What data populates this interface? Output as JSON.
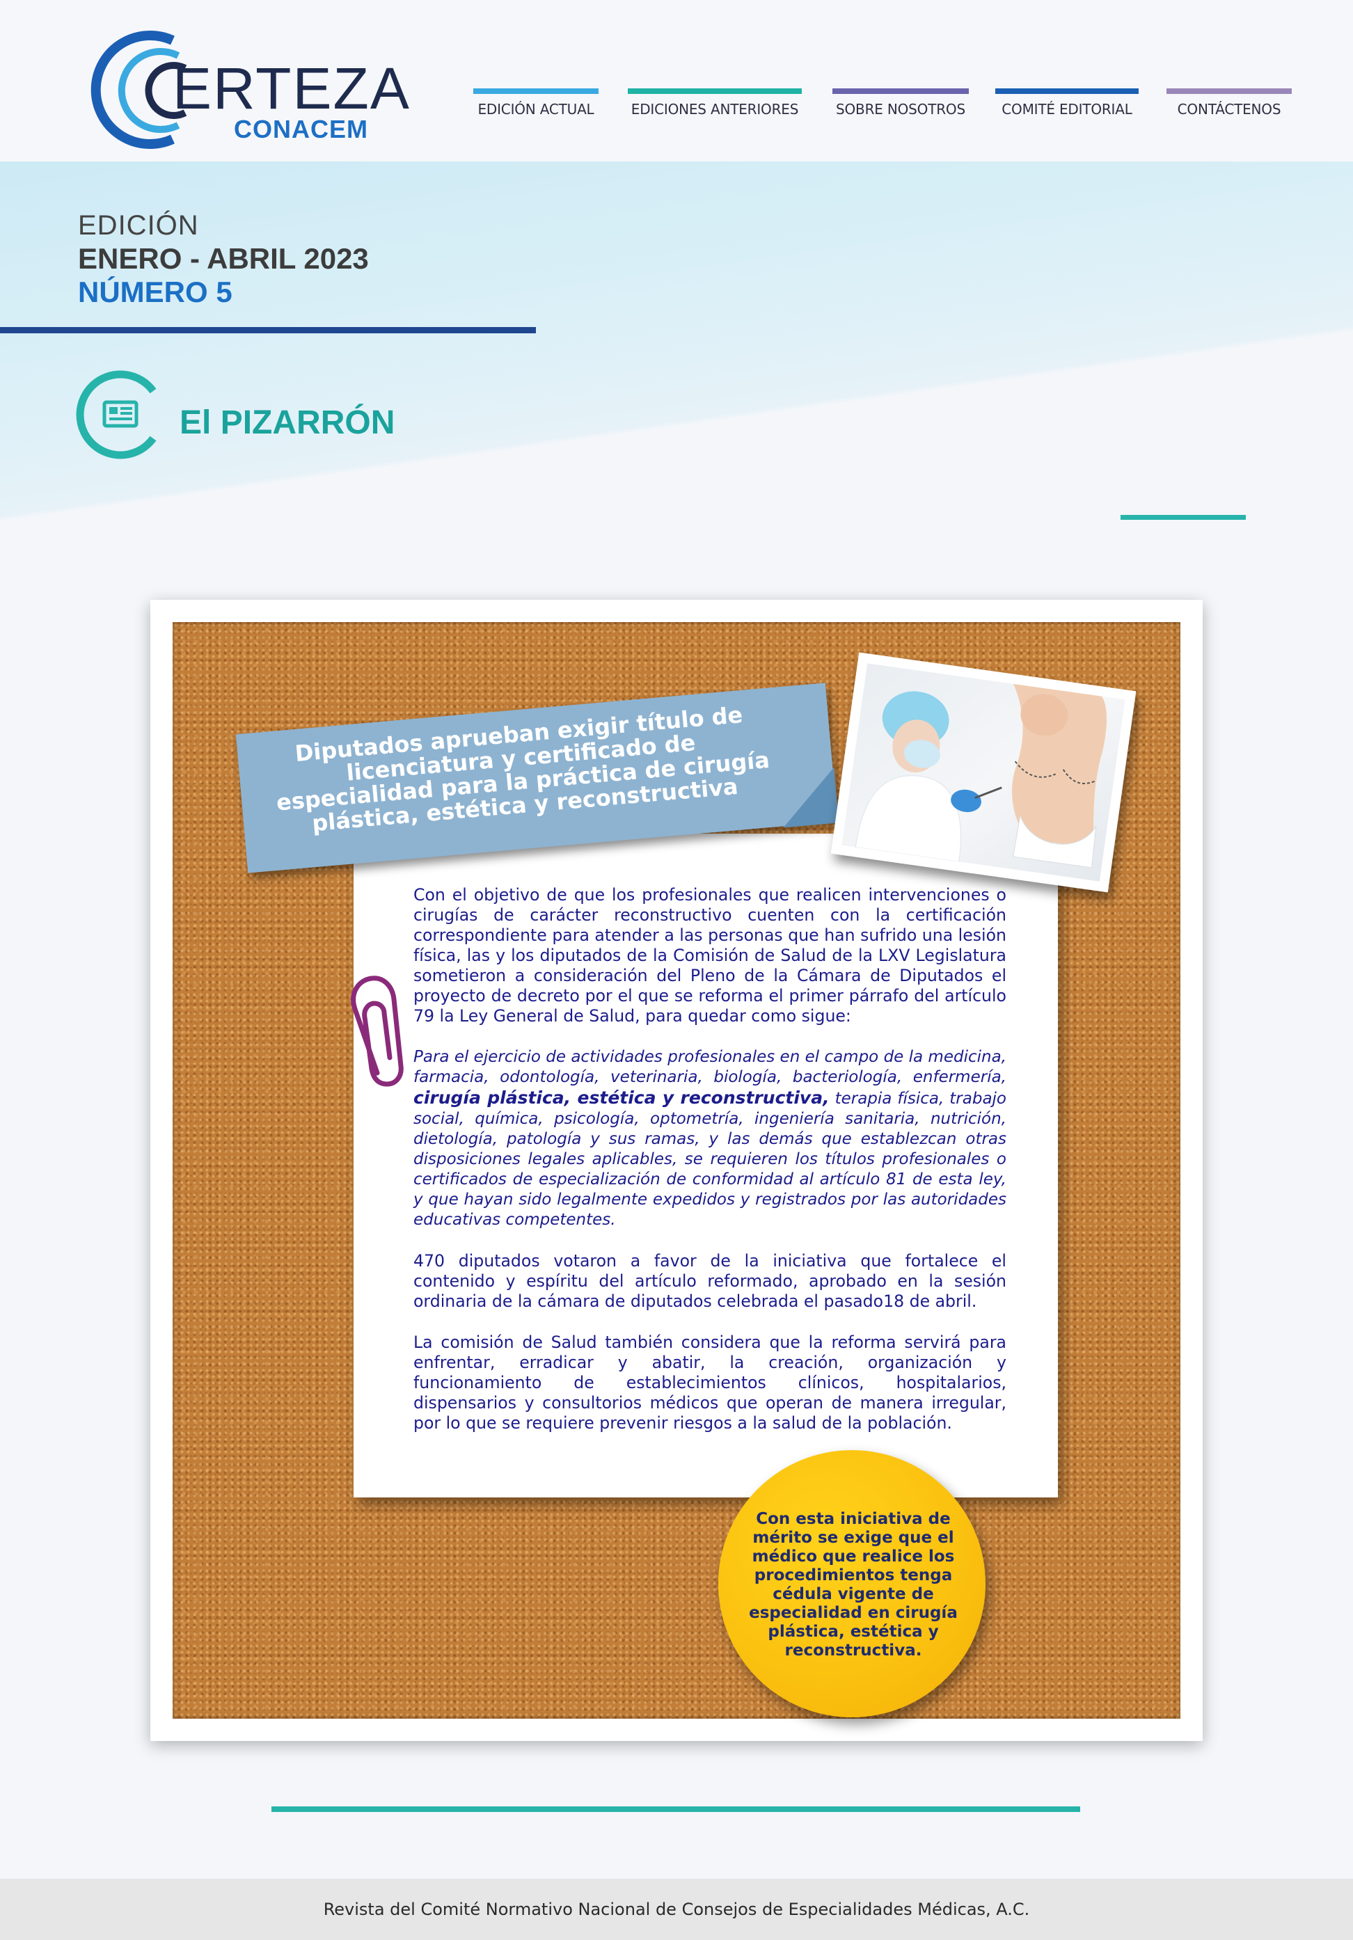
{
  "brand": {
    "logo_word": "ERTEZA",
    "logo_sub": "CONACEM"
  },
  "nav": {
    "items": [
      {
        "label": "EDICIÓN ACTUAL",
        "color": "#3aa9e0"
      },
      {
        "label": "EDICIONES ANTERIORES",
        "color": "#1fb3a6"
      },
      {
        "label": "SOBRE NOSOTROS",
        "color": "#6a64ad"
      },
      {
        "label": "COMITÉ EDITORIAL",
        "color": "#1b5fb5"
      },
      {
        "label": "CONTÁCTENOS",
        "color": "#9a87b9"
      }
    ]
  },
  "edition": {
    "label": "EDICIÓN",
    "date": "ENERO - ABRIL 2023",
    "number": "NÚMERO 5"
  },
  "section": {
    "title": "El PIZARRÓN",
    "icon": "newspaper-icon"
  },
  "board": {
    "headline": "Diputados aprueban exigir título de licenciatura y certificado de especialidad para la práctica de cirugía plástica, estética y reconstructiva",
    "paragraph_1": "Con el objetivo de que los profesionales que realicen intervenciones o cirugías de carácter reconstructivo cuenten con la certificación correspondiente para atender a las personas que han sufrido una lesión física, las y los diputados de la Comisión de Salud de la LXV Legislatura sometieron a consideración del Pleno de la Cámara de Diputados el proyecto de decreto por el que se reforma el primer párrafo del artículo 79 la Ley General de Salud, para quedar como sigue:",
    "quote_before": "Para el ejercicio de actividades profesionales en el campo de la medicina, farmacia, odontología, veterinaria, biología, bacteriología, enfermería, ",
    "quote_emphasis": "cirugía plástica, estética y reconstructiva,",
    "quote_after": " terapia física, trabajo social, química, psicología, optometría, ingeniería sanitaria, nutrición, dietología, patología y sus ramas, y las demás que establezcan otras disposiciones legales aplicables, se requieren los títulos profesionales o certificados de especialización de conformidad al artículo 81 de esta ley, y que hayan sido legalmente expedidos y registrados por las autoridades educativas competentes.",
    "paragraph_3": "470 diputados votaron a favor de la iniciativa que fortalece el contenido y espíritu del artículo reformado, aprobado en la sesión ordinaria de la cámara de diputados celebrada el pasado18 de abril.",
    "paragraph_4": "La comisión de Salud también considera que la reforma servirá para enfrentar, erradicar y abatir, la creación, organización y funcionamiento de establecimientos clínicos, hospitalarios, dispensarios y consultorios médicos que operan de manera irregular, por lo que se requiere prevenir riesgos a la salud de la población.",
    "callout": "Con esta iniciativa de mérito se exige que el médico que realice los procedimientos tenga cédula vigente de especialidad en cirugía plástica, estética y reconstructiva."
  },
  "footer": {
    "text": "Revista del Comité Normativo Nacional de Consejos de Especialidades Médicas, A.C."
  },
  "colors": {
    "accent_teal": "#26b3aa",
    "accent_navy": "#1f4790",
    "text_blue": "#1c1c8c",
    "callout_yellow": "#fbc210"
  }
}
